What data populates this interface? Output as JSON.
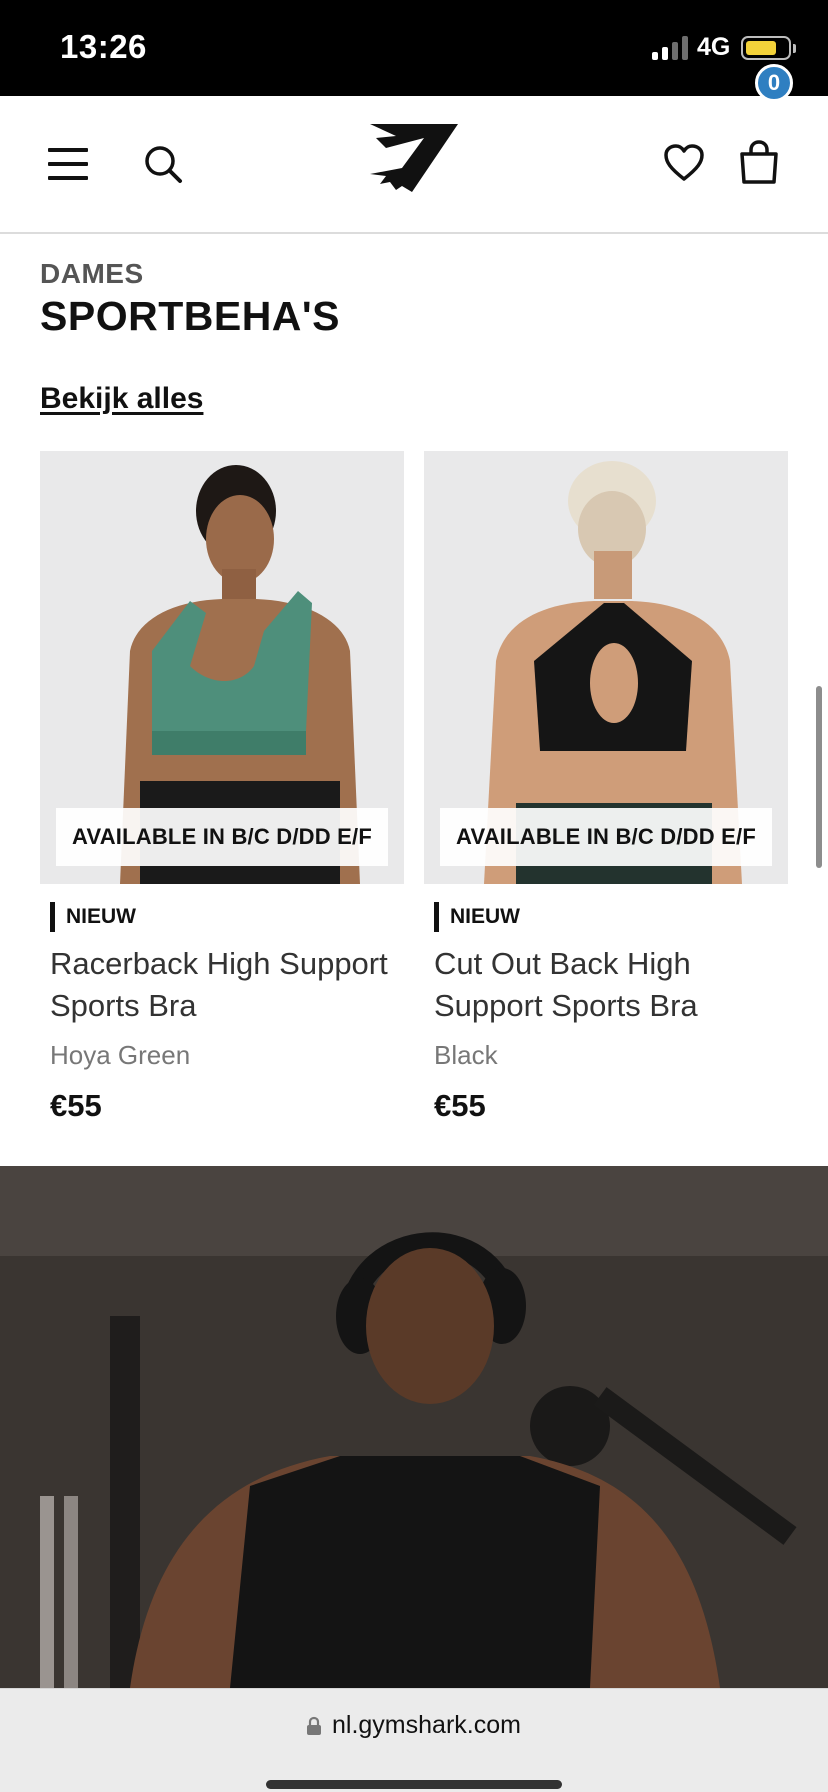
{
  "status_bar": {
    "time": "13:26",
    "network": "4G",
    "battery_level": 0.75,
    "battery_color": "#f3d23a"
  },
  "header": {
    "icons": [
      "menu-icon",
      "search-icon",
      "gymshark-logo",
      "heart-icon",
      "bag-icon"
    ],
    "cart_count": "0",
    "badge_color": "#2f7fc1"
  },
  "category": {
    "subtitle": "DAMES",
    "title": "SPORTBEHA'S",
    "view_all": "Bekijk alles"
  },
  "products": [
    {
      "badge": "AVAILABLE IN B/C D/DD E/F",
      "tag": "NIEUW",
      "name": "Racerback High Support Sports Bra",
      "color": "Hoya Green",
      "price": "€55",
      "swatch": "#4e8f7b"
    },
    {
      "badge": "AVAILABLE IN B/C D/DD E/F",
      "tag": "NIEUW",
      "name": "Cut Out Back High Support Sports Bra",
      "color": "Black",
      "price": "€55",
      "swatch": "#151515"
    }
  ],
  "browser": {
    "url": "nl.gymshark.com"
  }
}
